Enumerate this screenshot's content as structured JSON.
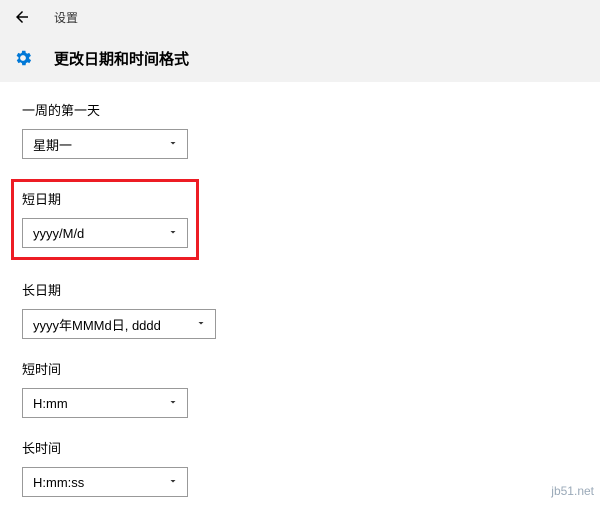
{
  "header": {
    "top_title": "设置",
    "page_heading": "更改日期和时间格式"
  },
  "fields": {
    "first_day": {
      "label": "一周的第一天",
      "value": "星期一"
    },
    "short_date": {
      "label": "短日期",
      "value": "yyyy/M/d"
    },
    "long_date": {
      "label": "长日期",
      "value": "yyyy年MMMd日, dddd"
    },
    "short_time": {
      "label": "短时间",
      "value": "H:mm"
    },
    "long_time": {
      "label": "长时间",
      "value": "H:mm:ss"
    }
  },
  "watermark": "jb51.net"
}
